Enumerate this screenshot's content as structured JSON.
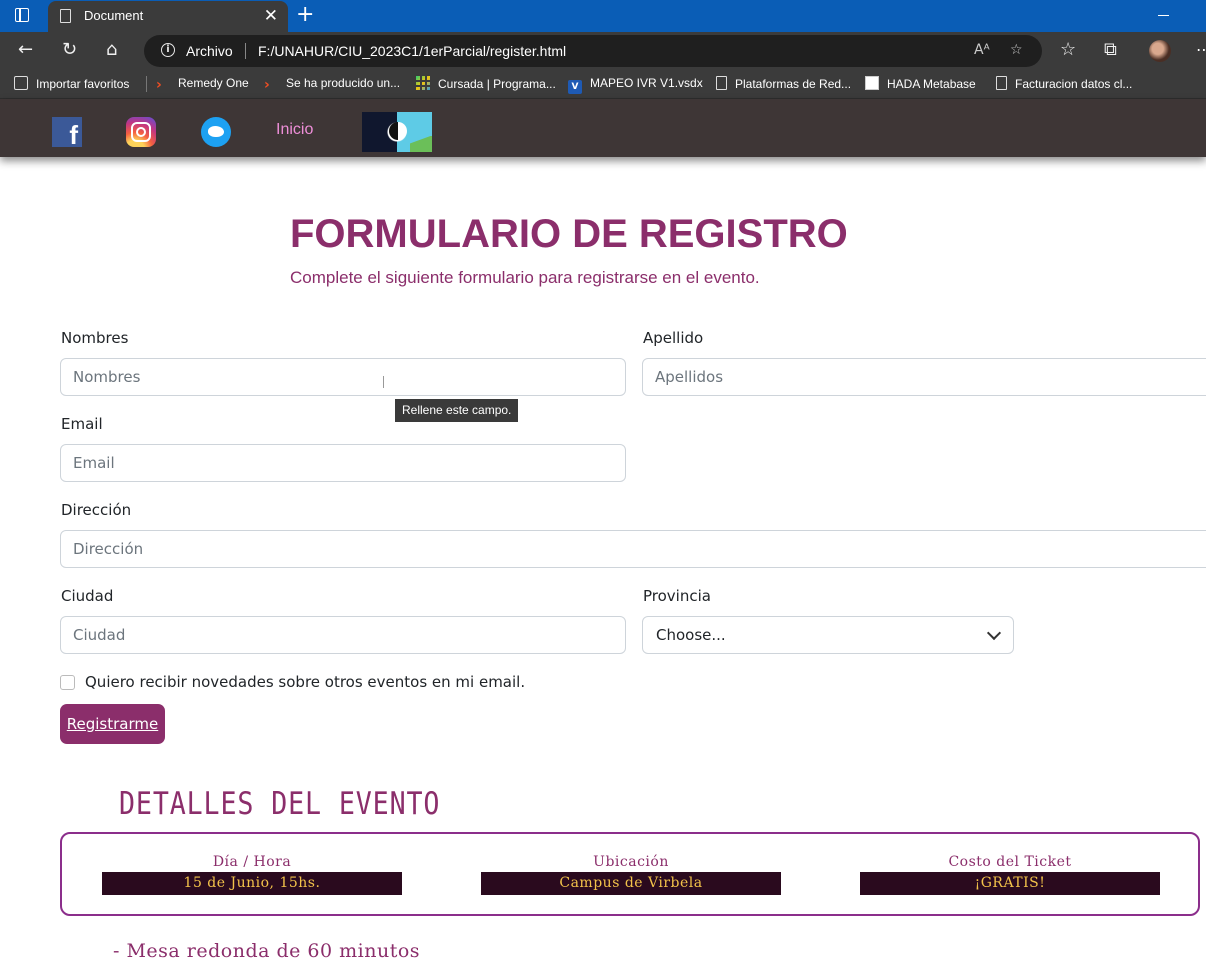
{
  "browser": {
    "tab_title": "Document",
    "tab_close": "✕",
    "new_tab": "+",
    "scheme_label": "Archivo",
    "url": "F:/UNAHUR/CIU_2023C1/1erParcial/register.html",
    "bookmarks": [
      {
        "label": "Importar favoritos",
        "icon": "import-icon"
      },
      {
        "label": "Remedy One",
        "icon": "remedy-icon"
      },
      {
        "label": "Se ha producido un...",
        "icon": "remedy-icon"
      },
      {
        "label": "Cursada | Programa...",
        "icon": "grid-icon"
      },
      {
        "label": "MAPEO IVR V1.vsdx",
        "icon": "visio-icon"
      },
      {
        "label": "Plataformas de Red...",
        "icon": "page-icon"
      },
      {
        "label": "HADA Metabase",
        "icon": "hada-icon"
      },
      {
        "label": "Facturacion datos cl...",
        "icon": "page-icon"
      }
    ]
  },
  "nav": {
    "inicio": "Inicio",
    "social": [
      "facebook-icon",
      "instagram-icon",
      "twitter-icon"
    ]
  },
  "form": {
    "title": "FORMULARIO DE REGISTRO",
    "subtitle": "Complete el siguiente formulario para registrarse en el evento.",
    "nombres_label": "Nombres",
    "nombres_placeholder": "Nombres",
    "apellido_label": "Apellido",
    "apellido_placeholder": "Apellidos",
    "tooltip": "Rellene este campo.",
    "email_label": "Email",
    "email_placeholder": "Email",
    "direccion_label": "Dirección",
    "direccion_placeholder": "Dirección",
    "ciudad_label": "Ciudad",
    "ciudad_placeholder": "Ciudad",
    "provincia_label": "Provincia",
    "provincia_value": "Choose...",
    "newsletter_label": "Quiero recibir novedades sobre otros eventos en mi email.",
    "submit_label": "Registrarme"
  },
  "details": {
    "title": "DETALLES DEL EVENTO",
    "columns": [
      {
        "heading": "Día / Hora",
        "value": "15 de Junio, 15hs."
      },
      {
        "heading": "Ubicación",
        "value": "Campus de Virbela"
      },
      {
        "heading": "Costo del Ticket",
        "value": "¡GRATIS!"
      }
    ],
    "bullet": "- Mesa redonda de 60 minutos"
  },
  "colors": {
    "accent": "#8b2e6b",
    "nav_bg": "#3e3636",
    "value_bg": "#2a0a1e",
    "value_text": "#f2c24a"
  }
}
